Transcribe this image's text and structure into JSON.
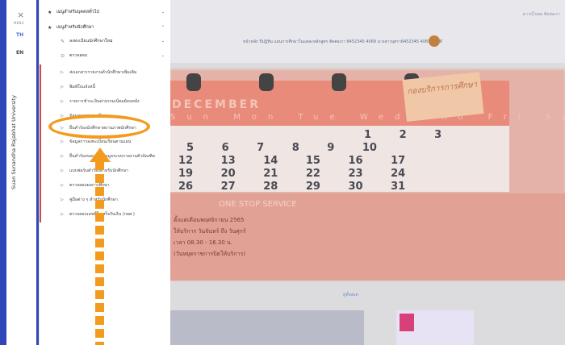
{
  "rail": {
    "close_glyph": "×",
    "menu_label": "MENU",
    "lang_th": "TH",
    "lang_en": "EN",
    "university_name": "Suan Sunandha Rajabhat University"
  },
  "menu": {
    "categories": [
      {
        "label": "เมนูสำหรับบุคคลทั่วไป"
      },
      {
        "label": "เมนูสำหรับนักศึกษา"
      }
    ],
    "subsections": [
      {
        "label": "ลงทะเบียนนักศึกษาใหม่"
      },
      {
        "label": "ตรวจสอบ"
      }
    ],
    "items": [
      {
        "label": "ส่งเอกสารรายงานตัวนักศึกษาเพิ่มเติม"
      },
      {
        "label": "พิมพ์ใบแจ้งหนี้"
      },
      {
        "label": "รายการชำระเงินค่าธรรมเนียมย้อนหลัง"
      },
      {
        "label": "ข้อมูลการลงทะเบียน"
      },
      {
        "label": "ยื่นคำร้องนักศึกษาสถานภาพนักศึกษา"
      },
      {
        "label": "ข้อมูลการลงทะเบียนเรียนตามแผน"
      },
      {
        "label": "ยื่นคำร้องขอแก้ไขข้อมูลระบบรายงานตัวบัณฑิต"
      },
      {
        "label": "แบบฟอร์มคำร้องสำหรับนักศึกษา"
      },
      {
        "label": "ตรวจสอบผลการศึกษา"
      },
      {
        "label": "คู่มือต่าง ๆ สำหรับนักศึกษา"
      },
      {
        "label": "ตรวจสอบเลขที่ใบเสร็จรับเงิน (กยศ.)"
      }
    ]
  },
  "site": {
    "top_right": "ดาวน์โหลด  ติดต่อเรา",
    "nav": "หน้าหลัก   ปีปฏิทิน   แผนการศึกษาในแต่ละหลักสูตร   ติดต่อเรา   6452345 4069 นางสาวบุศรา6452345 4069 สมบดี",
    "calendar_title": "DECEMBER",
    "dow": "Sun Mon Tue Wed Thu Fri Sat",
    "rows": [
      "1 2 3",
      "5 6 7 8 9 10",
      "12 13 14 15 16 17",
      "19 20 21 22 23 24",
      "26 27 28 29 30 31"
    ],
    "stamp": "กองบริการการศึกษา",
    "promo_heading": "ONE STOP SERVICE",
    "promo_lines": [
      "ตั้งแต่เดือนพฤศจิกายน 2565",
      "ให้บริการ วันจันทร์ ถึง วันศุกร์",
      "เวลา 08.30 - 16.30 น.",
      "(วันหยุดราชการปิดให้บริการ)"
    ],
    "see_more": "ดูทั้งหมด"
  },
  "colors": {
    "background": "#2f47b8",
    "accent_orange": "#f39b1f",
    "active_bar": "#d24a4a"
  }
}
